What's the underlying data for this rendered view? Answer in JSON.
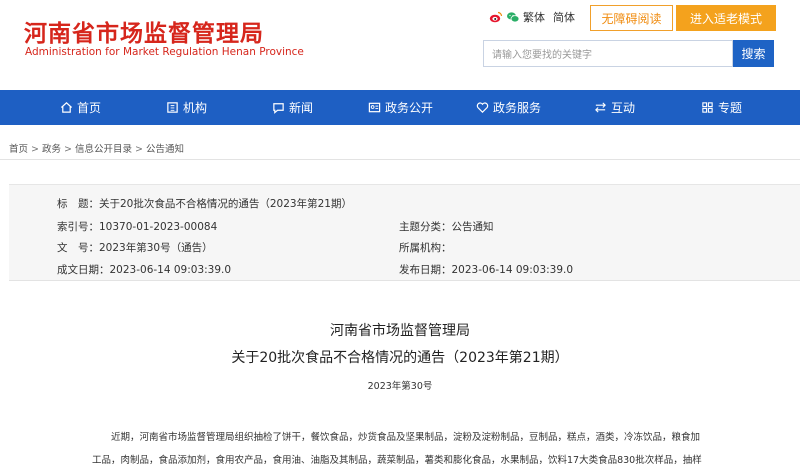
{
  "header": {
    "logo_cn": "河南省市场监督管理局",
    "logo_en": "Administration for Market Regulation Henan Province",
    "lang_traditional": "繁体",
    "lang_simplified": "简体",
    "accessible_read": "无障碍阅读",
    "elder_mode": "进入适老模式",
    "search_placeholder": "请输入您要找的关键字",
    "search_button": "搜索"
  },
  "nav": {
    "items": [
      {
        "label": "首页",
        "icon": "home-icon"
      },
      {
        "label": "机构",
        "icon": "building-icon"
      },
      {
        "label": "新闻",
        "icon": "chat-icon"
      },
      {
        "label": "政务公开",
        "icon": "id-card-icon"
      },
      {
        "label": "政务服务",
        "icon": "heart-icon"
      },
      {
        "label": "互动",
        "icon": "swap-icon"
      },
      {
        "label": "专题",
        "icon": "grid-icon"
      }
    ]
  },
  "breadcrumb": [
    "首页",
    "政务",
    "信息公开目录",
    "公告通知"
  ],
  "meta": {
    "title_label": "标　题：",
    "title_value": "关于20批次食品不合格情况的通告（2023年第21期）",
    "index_label": "索引号：",
    "index_value": "10370-01-2023-00084",
    "category_label": "主题分类：",
    "category_value": "公告通知",
    "docno_label": "文　号：",
    "docno_value": "2023年第30号（通告）",
    "org_label": "所属机构：",
    "org_value": "",
    "created_label": "成文日期：",
    "created_value": "2023-06-14 09:03:39.0",
    "published_label": "发布日期：",
    "published_value": "2023-06-14 09:03:39.0"
  },
  "article": {
    "title_line1": "河南省市场监督管理局",
    "title_line2": "关于20批次食品不合格情况的通告（2023年第21期）",
    "doc_no": "2023年第30号",
    "body_line1": "近期，河南省市场监督管理局组织抽检了饼干，餐饮食品，炒货食品及坚果制品，淀粉及淀粉制品，豆制品，糕点，酒类，冷冻饮品，粮食加",
    "body_line2": "工品，肉制品，食品添加剂，食用农产品，食用油、油脂及其制品，蔬菜制品，薯类和膨化食品，水果制品，饮料17大类食品830批次样品，抽样"
  },
  "colors": {
    "brand_red": "#d6261c",
    "nav_blue": "#1e5fc3",
    "accent_orange": "#f4a21d"
  }
}
